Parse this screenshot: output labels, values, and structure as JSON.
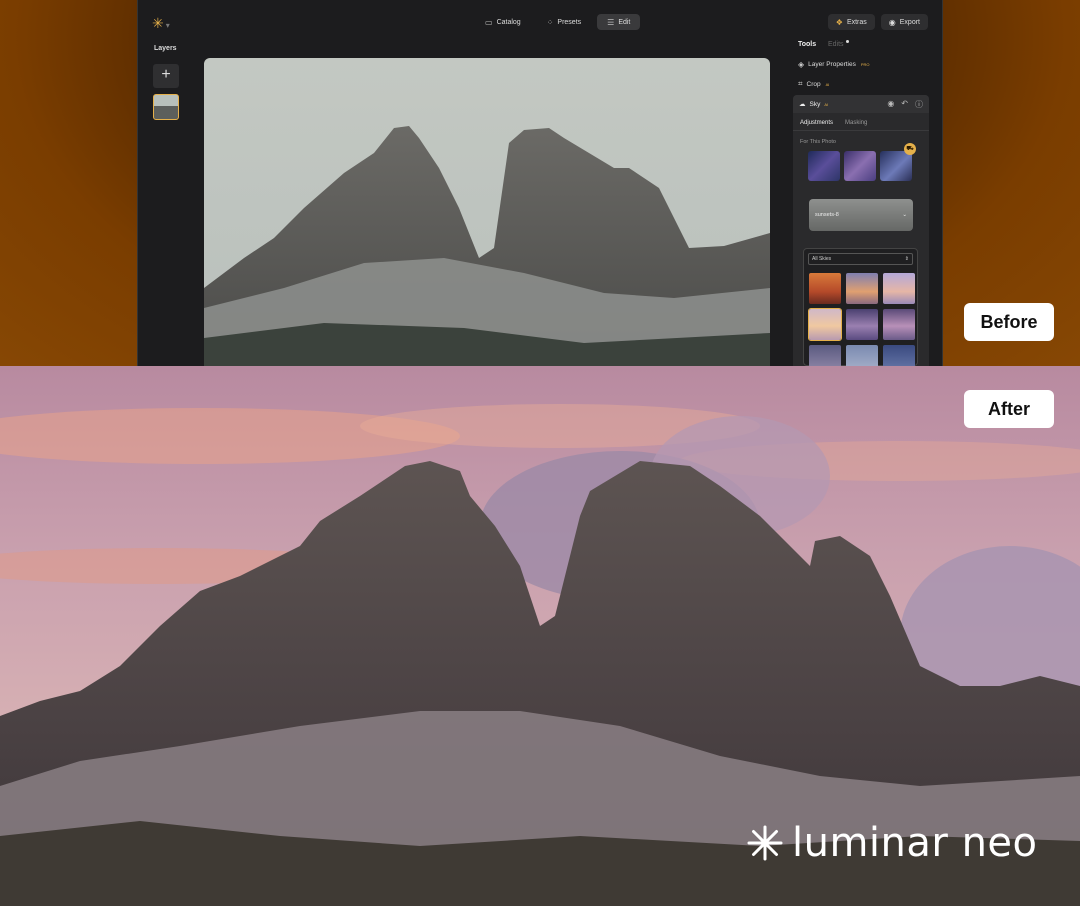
{
  "app": {
    "nav": [
      {
        "label": "Catalog",
        "icon": "catalog-icon"
      },
      {
        "label": "Presets",
        "icon": "presets-icon"
      },
      {
        "label": "Edit",
        "icon": "edit-sliders-icon",
        "active": true
      }
    ],
    "extras_label": "Extras",
    "export_label": "Export"
  },
  "layers": {
    "title": "Layers"
  },
  "tools": {
    "tab_tools": "Tools",
    "tab_edits": "Edits",
    "layer_properties": "Layer Properties",
    "layer_properties_badge": "PRO",
    "crop": "Crop",
    "crop_badge": "AI",
    "sky": {
      "title": "Sky",
      "title_badge": "AI",
      "tabs": [
        "Adjustments",
        "Masking"
      ],
      "for_this_photo": "For This Photo",
      "selected_sky": "sunsets-8",
      "filter": "All Skies"
    }
  },
  "labels": {
    "before": "Before",
    "after": "After"
  },
  "brand": {
    "name": "luminar neo"
  },
  "colors": {
    "accent": "#e5b04a",
    "panel": "#1c1c1e"
  }
}
